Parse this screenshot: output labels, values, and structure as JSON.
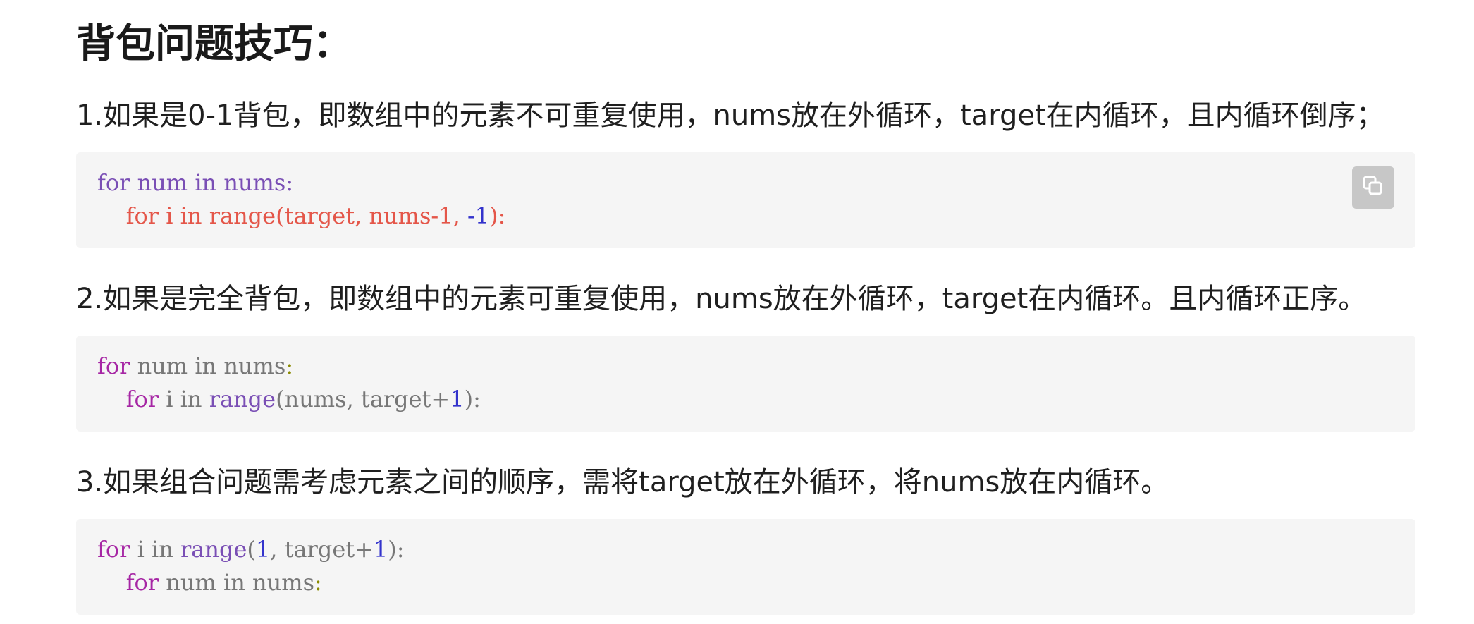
{
  "title": "背包问题技巧：",
  "paragraphs": [
    "1.如果是0-1背包，即数组中的元素不可重复使用，nums放在外循环，target在内循环，且内循环倒序；",
    "2.如果是完全背包，即数组中的元素可重复使用，nums放在外循环，target在内循环。且内循环正序。",
    "3.如果组合问题需考虑元素之间的顺序，需将target放在外循环，将nums放在内循环。"
  ],
  "code_blocks": [
    {
      "lines": [
        [
          {
            "t": "for",
            "c": "violet"
          },
          {
            "t": " ",
            "c": ""
          },
          {
            "t": "num",
            "c": "violet"
          },
          {
            "t": " ",
            "c": ""
          },
          {
            "t": "in",
            "c": "violet"
          },
          {
            "t": " ",
            "c": ""
          },
          {
            "t": "nums:",
            "c": "violet"
          }
        ],
        [
          {
            "t": "    ",
            "c": ""
          },
          {
            "t": "for",
            "c": "err"
          },
          {
            "t": " ",
            "c": ""
          },
          {
            "t": "i",
            "c": "err"
          },
          {
            "t": " ",
            "c": ""
          },
          {
            "t": "in",
            "c": "err"
          },
          {
            "t": " ",
            "c": ""
          },
          {
            "t": "range(target,",
            "c": "err"
          },
          {
            "t": " ",
            "c": ""
          },
          {
            "t": "nums-1,",
            "c": "err"
          },
          {
            "t": " ",
            "c": ""
          },
          {
            "t": "-1",
            "c": "num"
          },
          {
            "t": "):",
            "c": "err"
          }
        ]
      ],
      "copy_icon": "copy-icon"
    },
    {
      "lines": [
        [
          {
            "t": "for",
            "c": "kw"
          },
          {
            "t": " num in nums",
            "c": ""
          },
          {
            "t": ":",
            "c": "ol"
          }
        ],
        [
          {
            "t": "    ",
            "c": ""
          },
          {
            "t": "for",
            "c": "kw"
          },
          {
            "t": " i in ",
            "c": ""
          },
          {
            "t": "range",
            "c": "violet"
          },
          {
            "t": "(nums, target+",
            "c": ""
          },
          {
            "t": "1",
            "c": "num"
          },
          {
            "t": "):",
            "c": ""
          }
        ]
      ]
    },
    {
      "lines": [
        [
          {
            "t": "for",
            "c": "kw"
          },
          {
            "t": " i in ",
            "c": ""
          },
          {
            "t": "range",
            "c": "violet"
          },
          {
            "t": "(",
            "c": ""
          },
          {
            "t": "1",
            "c": "num"
          },
          {
            "t": ", target+",
            "c": ""
          },
          {
            "t": "1",
            "c": "num"
          },
          {
            "t": "):",
            "c": ""
          }
        ],
        [
          {
            "t": "    ",
            "c": ""
          },
          {
            "t": "for",
            "c": "kw"
          },
          {
            "t": " num in nums",
            "c": ""
          },
          {
            "t": ":",
            "c": "ol"
          }
        ]
      ]
    }
  ]
}
